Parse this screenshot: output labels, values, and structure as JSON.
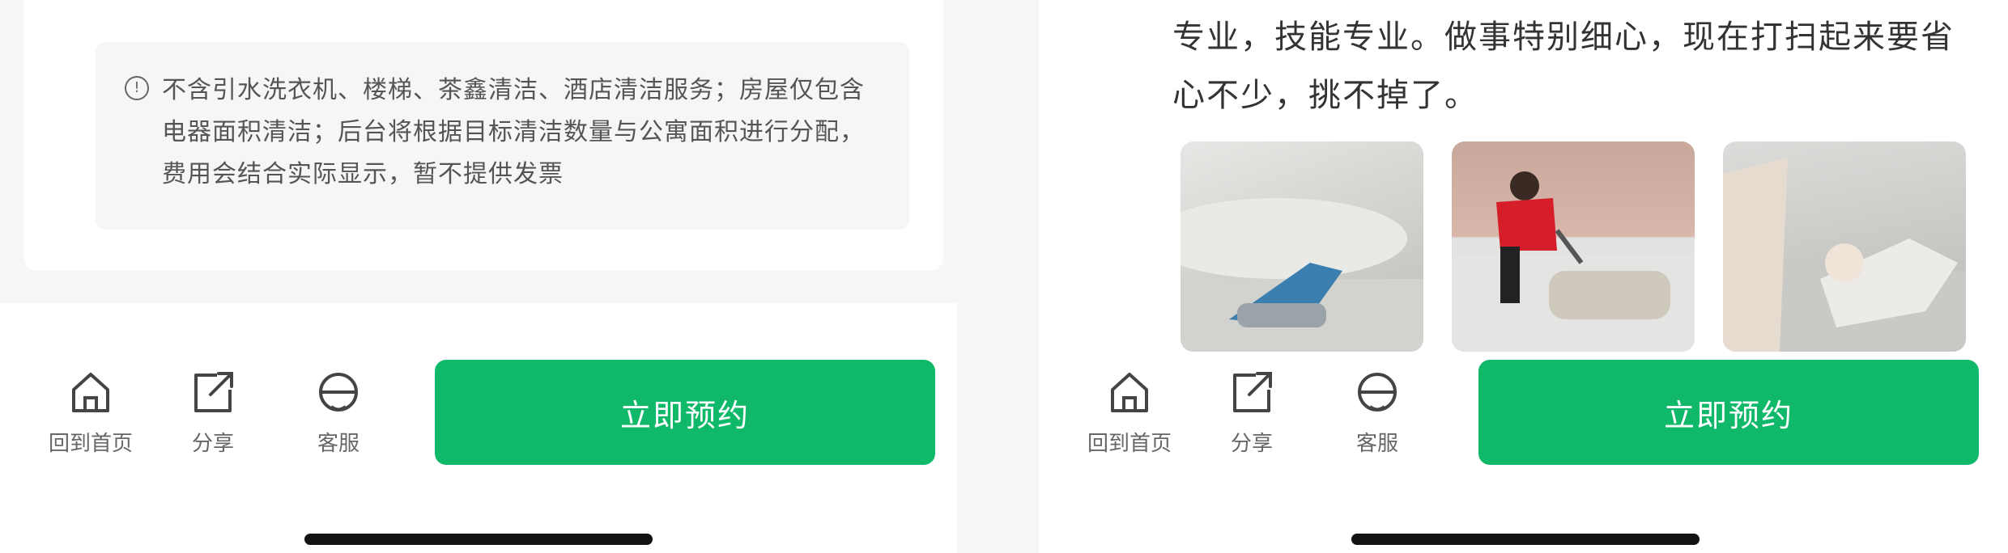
{
  "left": {
    "notice_text": "不含引水洗衣机、楼梯、茶鑫清洁、酒店清洁服务；房屋仅包含电器面积清洁；后台将根据目标清洁数量与公寓面积进行分配，费用会结合实际显示，暂不提供发票"
  },
  "right": {
    "paragraph": "专业，技能专业。做事特别细心，现在打扫起来要省心不少，挑不掉了。"
  },
  "bottom_bar": {
    "home_label": "回到首页",
    "share_label": "分享",
    "service_label": "客服",
    "buy_label": "立即预约"
  },
  "icons": [
    "home-icon",
    "share-icon",
    "customer-service-icon"
  ],
  "colors": {
    "buy_button": "#10b86a",
    "background": "#f2f3f5"
  }
}
